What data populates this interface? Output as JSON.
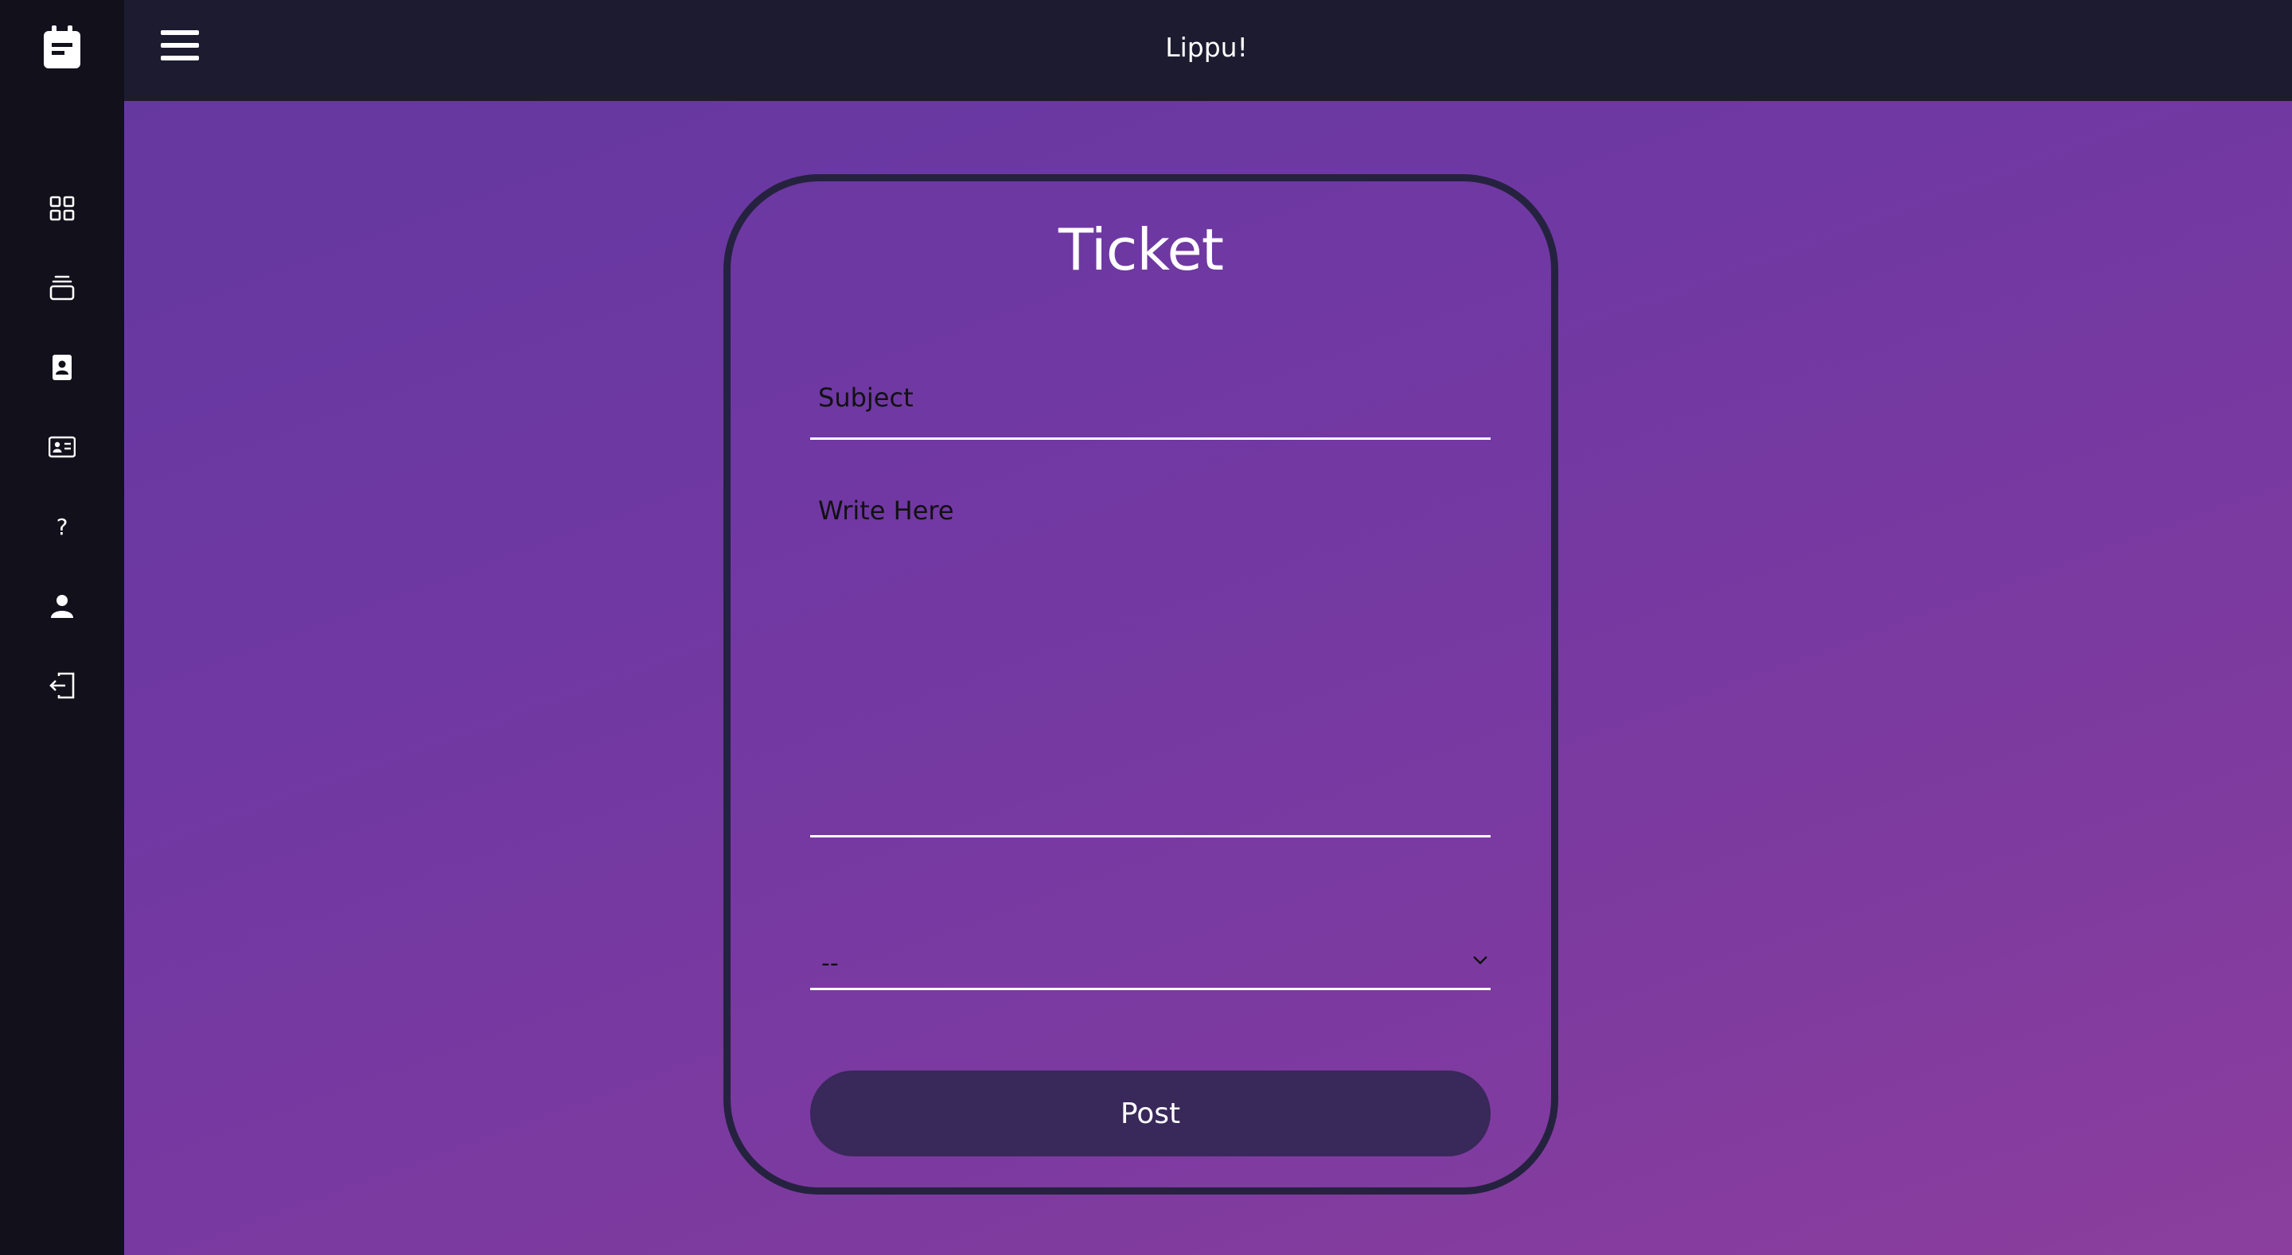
{
  "app": {
    "title": "Lippu!"
  },
  "sidebar": {
    "logo_icon": "calendar-note-icon",
    "items": [
      {
        "icon": "grid-icon",
        "label": "dashboard"
      },
      {
        "icon": "stack-icon",
        "label": "tickets"
      },
      {
        "icon": "contact-book-icon",
        "label": "contacts"
      },
      {
        "icon": "id-card-icon",
        "label": "profile-card"
      },
      {
        "icon": "question-icon",
        "label": "help"
      },
      {
        "icon": "user-icon",
        "label": "account"
      },
      {
        "icon": "logout-icon",
        "label": "logout"
      }
    ]
  },
  "ticket_form": {
    "title": "Ticket",
    "subject_placeholder": "Subject",
    "message_placeholder": "Write Here",
    "category_selected": "--",
    "post_label": "Post"
  },
  "colors": {
    "sidebar_bg": "#11101b",
    "topbar_bg": "#1d1b30",
    "gradient_start": "#6538a0",
    "gradient_end": "#8b3e9d",
    "card_border": "#25223f",
    "button_bg": "#39285a"
  }
}
